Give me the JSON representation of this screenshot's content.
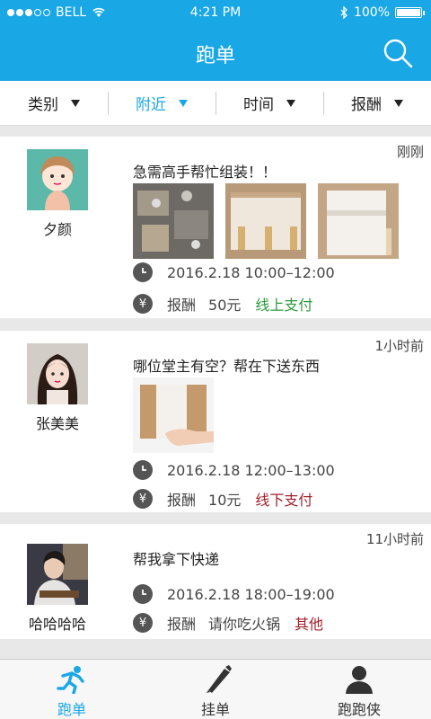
{
  "status": {
    "carrier": "BELL",
    "time": "4:21 PM",
    "battery": "100%"
  },
  "nav": {
    "title": "跑单"
  },
  "filters": [
    {
      "label": "类别",
      "active": false
    },
    {
      "label": "附近",
      "active": true
    },
    {
      "label": "时间",
      "active": false
    },
    {
      "label": "报酬",
      "active": false
    }
  ],
  "posts": [
    {
      "user": "夕颜",
      "time_ago": "刚刚",
      "title": "急需高手帮忙组装！！",
      "datetime": "2016.2.18 10:00–12:00",
      "reward_label": "报酬",
      "reward": "50元",
      "payment": "线上支付"
    },
    {
      "user": "张美美",
      "time_ago": "1小时前",
      "title": "哪位堂主有空？帮在下送东西",
      "datetime": "2016.2.18 12:00–13:00",
      "reward_label": "报酬",
      "reward": "10元",
      "payment": "线下支付"
    },
    {
      "user": "哈哈哈哈",
      "time_ago": "11小时前",
      "title": "帮我拿下快递",
      "datetime": "2016.2.18 18:00–19:00",
      "reward_label": "报酬",
      "reward": "请你吃火锅",
      "payment": "其他"
    }
  ],
  "tabs": [
    {
      "label": "跑单",
      "active": true
    },
    {
      "label": "挂单",
      "active": false
    },
    {
      "label": "跑跑侠",
      "active": false
    }
  ],
  "colors": {
    "accent": "#1aa7e6",
    "online": "#2a9a3e",
    "offline": "#a1202a"
  }
}
